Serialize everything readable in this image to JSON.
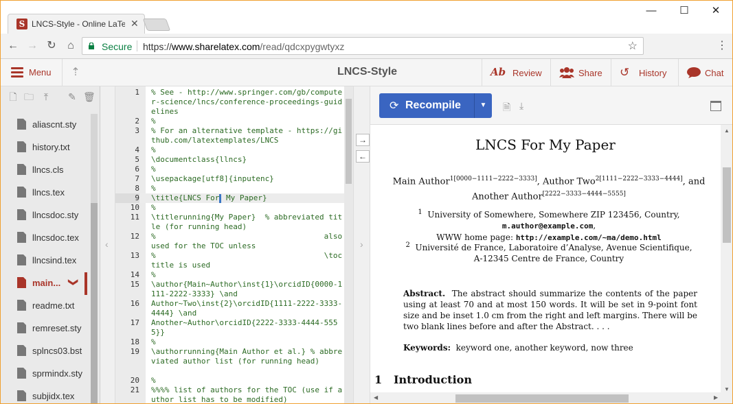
{
  "browser": {
    "tab_title": "LNCS-Style - Online LaTe",
    "tab_favicon": "S",
    "secure_label": "Secure",
    "url_scheme": "https://",
    "url_host": "www.sharelatex.com",
    "url_path": "/read/qdcxpygwtyxz"
  },
  "toolbar": {
    "menu_label": "Menu",
    "project_title": "LNCS-Style",
    "review_label": "Review",
    "share_label": "Share",
    "history_label": "History",
    "chat_label": "Chat"
  },
  "filetree": {
    "files": [
      {
        "name": "aliascnt.sty"
      },
      {
        "name": "history.txt"
      },
      {
        "name": "llncs.cls"
      },
      {
        "name": "llncs.tex"
      },
      {
        "name": "llncsdoc.sty"
      },
      {
        "name": "llncsdoc.tex"
      },
      {
        "name": "llncsind.tex"
      },
      {
        "name": "main..."
      },
      {
        "name": "readme.txt"
      },
      {
        "name": "remreset.sty"
      },
      {
        "name": "splncs03.bst"
      },
      {
        "name": "sprmindx.sty"
      },
      {
        "name": "subjidx.tex"
      }
    ]
  },
  "editor": {
    "lines": [
      {
        "n": "1",
        "t": "% See - http://www.springer.com/gb/computer-science/lncs/conference-proceedings-guidelines"
      },
      {
        "n": "2",
        "t": "%"
      },
      {
        "n": "3",
        "t": "% For an alternative template - https://github.com/latextemplates/LNCS"
      },
      {
        "n": "4",
        "t": "%"
      },
      {
        "n": "5",
        "t": "\\documentclass{llncs}"
      },
      {
        "n": "6",
        "t": "%"
      },
      {
        "n": "7",
        "t": "\\usepackage[utf8]{inputenc}"
      },
      {
        "n": "8",
        "t": "%"
      },
      {
        "n": "9",
        "t_before": "\\title{LNCS For",
        "t_after": " My Paper}"
      },
      {
        "n": "10",
        "t": "%"
      },
      {
        "n": "11",
        "t": "\\titlerunning{My Paper}  % abbreviated title (for running head)"
      },
      {
        "n": "12",
        "t": "%                                     also used for the TOC unless"
      },
      {
        "n": "13",
        "t": "%                                     \\toctitle is used"
      },
      {
        "n": "14",
        "t": "%"
      },
      {
        "n": "15",
        "t": "\\author{Main~Author\\inst{1}\\orcidID{0000-1111-2222-3333} \\and"
      },
      {
        "n": "16",
        "t": "Author~Two\\inst{2}\\orcidID{1111-2222-3333-4444} \\and"
      },
      {
        "n": "17",
        "t": "Another~Author\\orcidID{2222-3333-4444-5555}}"
      },
      {
        "n": "18",
        "t": "%"
      },
      {
        "n": "19",
        "t": "\\authorrunning{Main Author et al.} % abbreviated author list (for running head)"
      },
      {
        "n": "20",
        "t": "%"
      },
      {
        "n": "21",
        "t": "%%%% list of authors for the TOC (use if author list has to be modified)"
      }
    ]
  },
  "pdf": {
    "recompile_label": "Recompile",
    "title": "LNCS For My Paper",
    "authors_line1_a": "Main Author",
    "authors_line1_a_sup": "1[0000−1111−2222−3333]",
    "authors_line1_b": ", Author Two",
    "authors_line1_b_sup": "2[1111−2222−3333−4444]",
    "authors_line1_c": ", and",
    "authors_line2": "Another Author",
    "authors_line2_sup": "[2222−3333−4444−5555]",
    "affil1_sup": "1",
    "affil1_line1": "University of Somewhere, Somewhere ZIP 123456, Country,",
    "affil1_email": "m.author@example.com",
    "affil1_comma": ",",
    "affil1_home_prefix": "WWW home page: ",
    "affil1_home_url": "http://example.com/~ma/demo.html",
    "affil2_sup": "2",
    "affil2_line1": "Université de France, Laboratoire d’Analyse, Avenue Scientifique,",
    "affil2_line2": "A-12345 Centre de France, Country",
    "abstract_label": "Abstract.",
    "abstract_text": "The abstract should summarize the contents of the paper using at least 70 and at most 150 words. It will be set in 9-point font size and be inset 1.0 cm from the right and left margins. There will be two blank lines before and after the Abstract. . . .",
    "keywords_label": "Keywords:",
    "keywords_text": "keyword one, another keyword, now three",
    "section_num": "1",
    "section_title": "Introduction"
  },
  "colors": {
    "accent": "#a93529",
    "recompile": "#3a65c1",
    "code": "#2b6a23",
    "secure": "#0b8043"
  }
}
